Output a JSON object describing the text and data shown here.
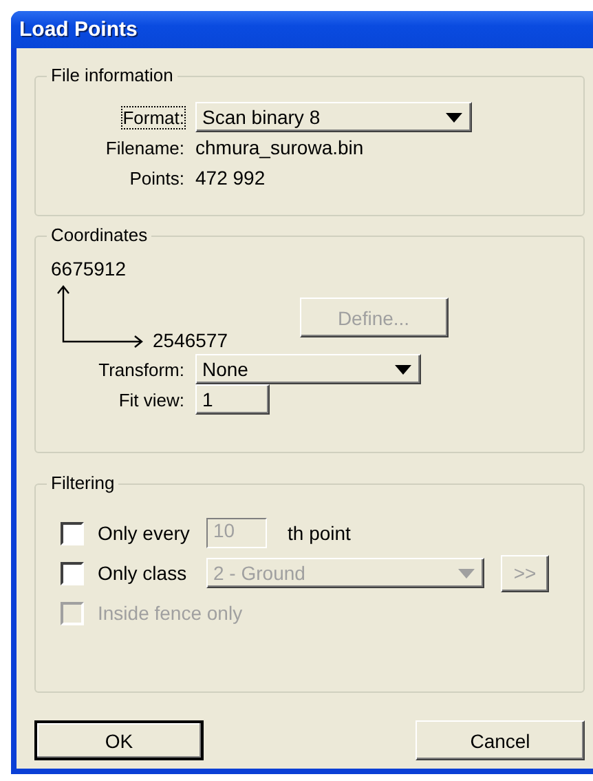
{
  "window": {
    "title": "Load Points"
  },
  "file_information": {
    "title": "File information",
    "format": {
      "label": "Format:",
      "value": "Scan binary 8",
      "focused": true
    },
    "filename": {
      "label": "Filename:",
      "value": "chmura_surowa.bin"
    },
    "points": {
      "label": "Points:",
      "value": "472 992"
    }
  },
  "coordinates": {
    "title": "Coordinates",
    "y_value": "6675912",
    "x_value": "2546577",
    "define_button": {
      "label": "Define...",
      "disabled": true
    },
    "transform": {
      "label": "Transform:",
      "value": "None"
    },
    "fit_view": {
      "label": "Fit view:",
      "value": "1"
    }
  },
  "filtering": {
    "title": "Filtering",
    "options": [
      {
        "kind": "field",
        "label": "Only every",
        "checked": false,
        "disabled": false,
        "value": "10",
        "value_disabled": true,
        "suffix": "th point"
      },
      {
        "kind": "combo",
        "label": "Only class",
        "checked": false,
        "disabled": false,
        "value": "2 - Ground",
        "value_disabled": true,
        "button": ">>"
      },
      {
        "kind": "plain",
        "label": "Inside fence only",
        "checked": false,
        "disabled": true
      }
    ]
  },
  "buttons": [
    {
      "label": "OK",
      "default": true
    },
    {
      "label": "Cancel",
      "default": false
    }
  ]
}
